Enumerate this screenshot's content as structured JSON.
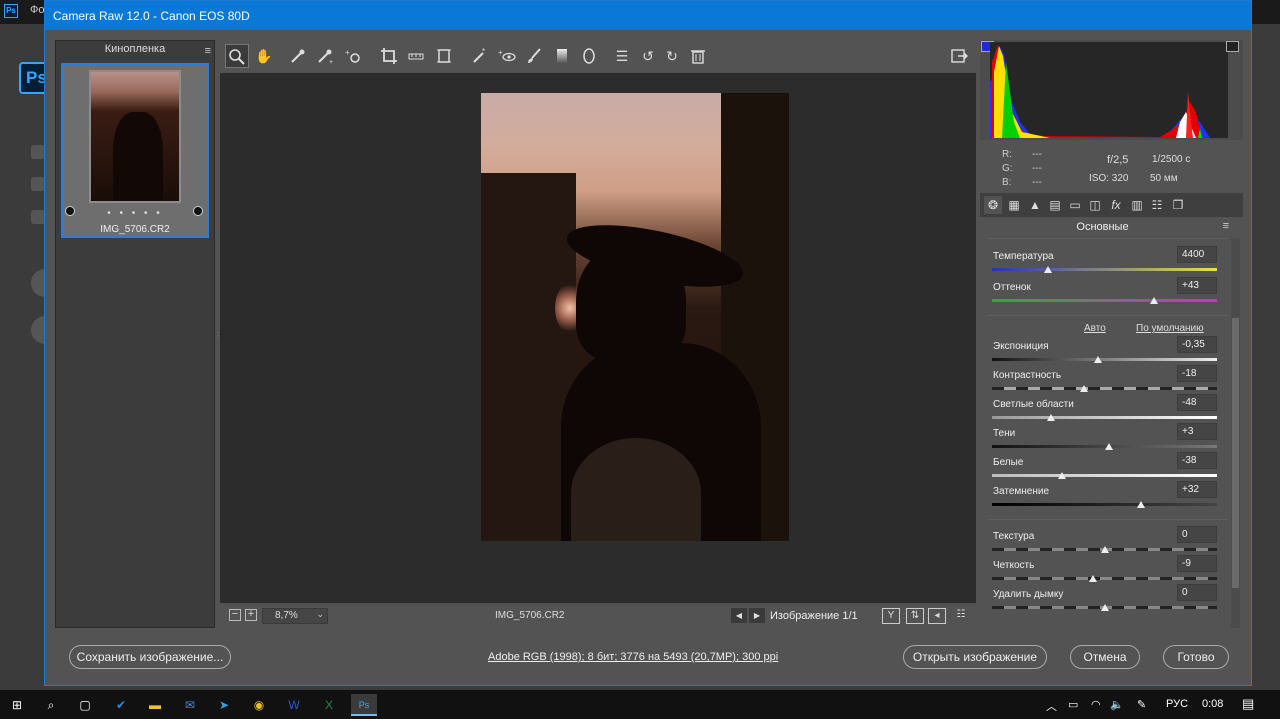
{
  "background": {
    "app_label": "Фо",
    "ps_logo": "Ps"
  },
  "window": {
    "title": "Camera Raw 12.0  -  Canon EOS 80D"
  },
  "filmstrip": {
    "title": "Кинопленка",
    "rating_dots": "• • • • •",
    "thumbnail_name": "IMG_5706.CR2"
  },
  "status": {
    "zoom": "8,7%",
    "filename": "IMG_5706.CR2",
    "image_count": "Изображение 1/1"
  },
  "info": {
    "r_label": "R:",
    "g_label": "G:",
    "b_label": "B:",
    "r": "---",
    "g": "---",
    "b": "---",
    "aperture": "f/2,5",
    "shutter": "1/2500 с",
    "iso": "ISO: 320",
    "focal": "50 мм"
  },
  "panel": {
    "title": "Основные",
    "auto": "Авто",
    "default": "По умолчанию",
    "sliders": [
      {
        "label": "Температура",
        "value": "4400",
        "level": 0.25
      },
      {
        "label": "Оттенок",
        "value": "+43",
        "level": 0.72
      },
      {
        "label": "Экспониция",
        "value": "-0,35",
        "level": 0.47
      },
      {
        "label": "Контрастность",
        "value": "-18",
        "level": 0.41
      },
      {
        "label": "Светлые области",
        "value": "-48",
        "level": 0.26
      },
      {
        "label": "Тени",
        "value": "+3",
        "level": 0.52
      },
      {
        "label": "Белые",
        "value": "-38",
        "level": 0.31
      },
      {
        "label": "Затемнение",
        "value": "+32",
        "level": 0.66
      },
      {
        "label": "Текстура",
        "value": "0",
        "level": 0.5
      },
      {
        "label": "Четкость",
        "value": "-9",
        "level": 0.45
      },
      {
        "label": "Удалить дымку",
        "value": "0",
        "level": 0.5
      }
    ]
  },
  "footer": {
    "save": "Сохранить изображение...",
    "workflow": "Adobe RGB (1998); 8 бит; 3776 на 5493 (20,7MP); 300 ppi",
    "open": "Открыть изображение",
    "cancel": "Отмена",
    "done": "Готово"
  },
  "taskbar": {
    "lang": "РУС",
    "time": "0:08"
  },
  "colors": {
    "title_bar": "#0a78d7",
    "accent": "#2f7ad6"
  }
}
